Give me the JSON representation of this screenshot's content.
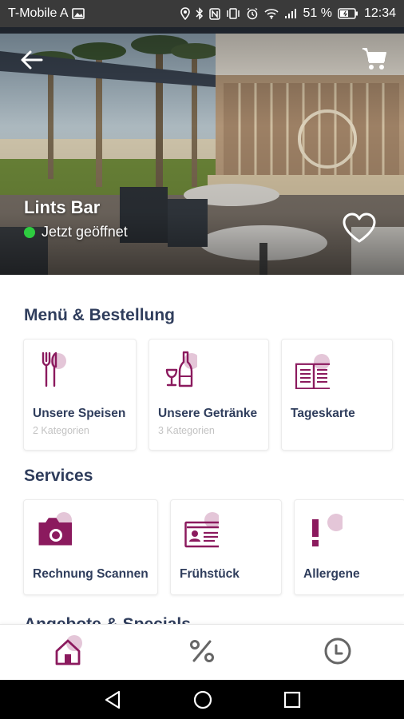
{
  "status_bar": {
    "carrier": "T-Mobile A",
    "battery": "51 %",
    "time": "12:34",
    "icons": [
      "image-icon",
      "location-icon",
      "bluetooth-icon",
      "nfc-icon",
      "vibrate-icon",
      "alarm-icon",
      "wifi-icon",
      "signal-icon",
      "battery-icon"
    ]
  },
  "header": {
    "venue_name": "Lints Bar",
    "open_status": "Jetzt geöffnet",
    "open_color": "#2ecc40",
    "icons": [
      "back-arrow-icon",
      "cart-icon",
      "heart-icon"
    ]
  },
  "menu_section": {
    "title": "Menü & Bestellung",
    "cards": [
      {
        "label": "Unsere Speisen",
        "sub": "2 Kategorien",
        "icon": "cutlery-icon"
      },
      {
        "label": "Unsere Getränke",
        "sub": "3 Kategorien",
        "icon": "drinks-icon"
      },
      {
        "label": "Tageskarte",
        "sub": "",
        "icon": "menu-book-icon"
      }
    ]
  },
  "services_section": {
    "title": "Services",
    "cards": [
      {
        "label": "Rechnung Scannen",
        "icon": "camera-icon"
      },
      {
        "label": "Frühstück",
        "icon": "id-card-icon"
      },
      {
        "label": "Allergene",
        "icon": "exclamation-icon"
      }
    ]
  },
  "next_section": {
    "title": "Angebote & Specials"
  },
  "bottom_nav": {
    "items": [
      {
        "name": "home",
        "icon": "home-icon",
        "active": true
      },
      {
        "name": "offers",
        "icon": "percent-icon",
        "active": false
      },
      {
        "name": "history",
        "icon": "clock-icon",
        "active": false
      }
    ]
  },
  "colors": {
    "accent": "#8b1a5e",
    "accent_light": "#e4c6d8",
    "title": "#2f3d5c",
    "muted": "#c3c3c3",
    "nav_inactive": "#666666"
  }
}
